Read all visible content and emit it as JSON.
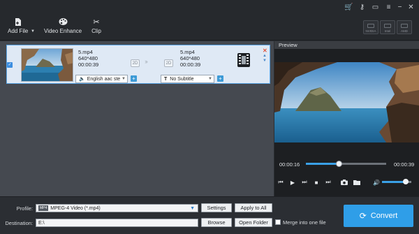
{
  "toolbar": {
    "add_file": "Add File",
    "video_enhance": "Video Enhance",
    "clip": "Clip",
    "accelerators": [
      "NVIDIA",
      "Intel",
      "AMD"
    ]
  },
  "file": {
    "source": {
      "name": "5.mp4",
      "resolution": "640*480",
      "duration": "00:00:39",
      "mode": "2D"
    },
    "output": {
      "name": "5.mp4",
      "resolution": "640*480",
      "duration": "00:00:39",
      "mode": "2D"
    },
    "audio_track": "English aac ste",
    "subtitle": "No Subtitle"
  },
  "preview": {
    "title": "Preview",
    "current_time": "00:00:16",
    "total_time": "00:00:39",
    "progress": 0.41,
    "volume": 0.8
  },
  "bottom": {
    "profile_label": "Profile:",
    "profile_value": "MPEG-4 Video (*.mp4)",
    "profile_icon_text": "MP4",
    "settings": "Settings",
    "apply_to_all": "Apply to All",
    "destination_label": "Destination:",
    "destination_value": "E:\\",
    "browse": "Browse",
    "open_folder": "Open Folder",
    "merge": "Merge into one file",
    "convert": "Convert"
  },
  "colors": {
    "accent": "#2f9ee8",
    "row_selected": "#dfe9f5",
    "panel": "#454950"
  }
}
